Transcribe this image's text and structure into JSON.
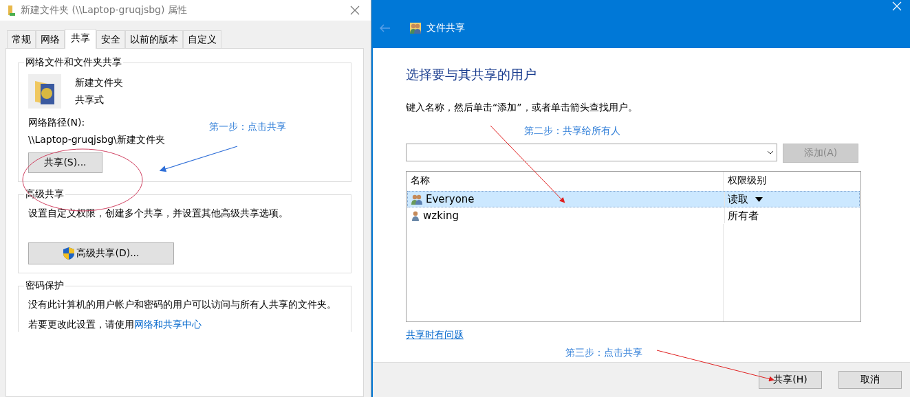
{
  "properties_dialog": {
    "title": "新建文件夹 (\\\\Laptop-gruqjsbg) 属性",
    "tabs": [
      {
        "label": "常规",
        "selected": false
      },
      {
        "label": "网络",
        "selected": false
      },
      {
        "label": "共享",
        "selected": true
      },
      {
        "label": "安全",
        "selected": false
      },
      {
        "label": "以前的版本",
        "selected": false
      },
      {
        "label": "自定义",
        "selected": false
      }
    ],
    "network_sharing": {
      "heading": "网络文件和文件夹共享",
      "folder_name": "新建文件夹",
      "share_state": "共享式",
      "path_label": "网络路径(N):",
      "path": "\\\\Laptop-gruqjsbg\\新建文件夹",
      "button": "共享(S)..."
    },
    "advanced_sharing": {
      "heading": "高级共享",
      "description": "设置自定义权限，创建多个共享，并设置其他高级共享选项。",
      "button": "高级共享(D)..."
    },
    "password_protection": {
      "heading": "密码保护",
      "description": "没有此计算机的用户帐户和密码的用户可以访问与所有人共享的文件夹。",
      "change_text": "若要更改此设置，请使用",
      "change_link": "网络和共享中心"
    }
  },
  "file_sharing": {
    "title": "文件共享",
    "heading": "选择要与其共享的用户",
    "instruction": "键入名称，然后单击“添加”，或者单击箭头查找用户。",
    "add_button": {
      "label": "添加(A)",
      "disabled": true
    },
    "table": {
      "columns": [
        "名称",
        "权限级别"
      ],
      "rows": [
        {
          "name": "Everyone",
          "kind": "group",
          "permission": "读取",
          "has_dropdown": true,
          "selected": true
        },
        {
          "name": "wzking",
          "kind": "user",
          "permission": "所有者",
          "has_dropdown": false,
          "selected": false
        }
      ]
    },
    "help_link": "共享时有问题",
    "buttons": [
      "共享(H)",
      "取消"
    ]
  },
  "annotations": [
    {
      "text": "第一步：点击共享"
    },
    {
      "text": "第二步：共享给所有人"
    },
    {
      "text": "第三步：点击共享"
    }
  ]
}
